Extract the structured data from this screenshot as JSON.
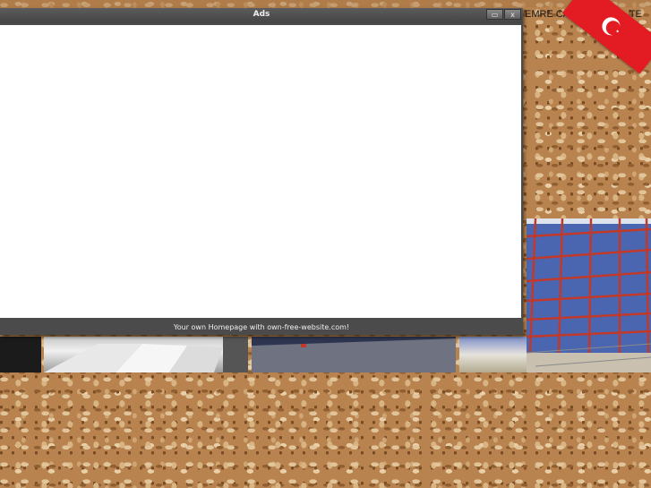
{
  "window": {
    "title": "Ads",
    "controls": {
      "minimize_label": "▭",
      "close_label": "x"
    },
    "footer_text": "Your own Homepage with own-free-website.com!"
  },
  "background": {
    "marquee_text": "EMRE CADDESİ N",
    "marquee_tail": "TE",
    "flag_icon": "turkey-flag-icon"
  },
  "colors": {
    "window_chrome": "#4b4b4b",
    "content_bg": "#ffffff",
    "flag_red": "#e31b23"
  }
}
